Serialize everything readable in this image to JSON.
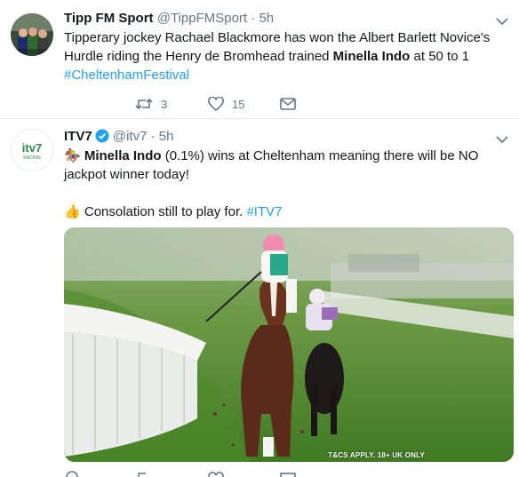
{
  "tweets": [
    {
      "name": "Tipp FM Sport",
      "handle": "@TippFMSport",
      "dot": "·",
      "time": "5h",
      "text_segments": {
        "p1": "Tipperary jockey Rachael Blackmore has won the Albert Barlett Novice's Hurdle riding the Henry de Bromhead trained ",
        "bold": "Minella Indo",
        "p2": " at 50 to 1",
        "hashtag": "#CheltenhamFestival"
      },
      "actions": {
        "reply_count": "",
        "retweet_count": "3",
        "like_count": "15"
      }
    },
    {
      "name": "ITV7",
      "handle": "@itv7",
      "dot": "·",
      "time": "5h",
      "avatar_text": "itv7",
      "avatar_sub": "RACING",
      "text_segments": {
        "emoji1": "🏇",
        "bold": "Minella Indo",
        "p1": " (0.1%) wins at Cheltenham meaning there will be NO jackpot winner today!",
        "emoji2": "👍",
        "p2": " Consolation still to play for. ",
        "hashtag": "#ITV7"
      },
      "media_caption": "T&CS APPLY. 18+ UK ONLY"
    }
  ],
  "colors": {
    "link": "#1da1f2",
    "muted": "#657786",
    "text": "#14171a",
    "divider": "#e6ecf0"
  }
}
